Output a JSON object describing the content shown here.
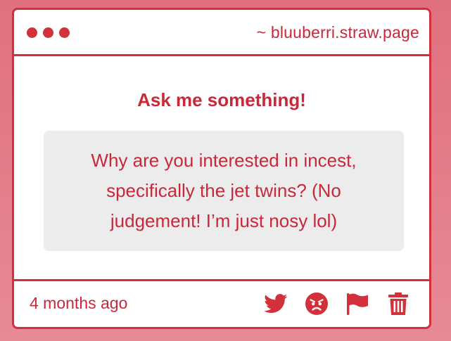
{
  "colors": {
    "accent": "#d2303a",
    "text": "#c8283a",
    "question_bg": "#ececec",
    "background_top": "#e0707e",
    "background_bottom": "#e78a96"
  },
  "window": {
    "dots": [
      "dot",
      "dot",
      "dot"
    ],
    "site_label": "~ bluuberri.straw.page"
  },
  "main": {
    "heading": "Ask me something!",
    "question": "Why are you interested in incest, specifically the jet twins? (No judgement! I’m just nosy lol)"
  },
  "footer": {
    "timestamp": "4 months ago",
    "actions": [
      {
        "name": "twitter-icon"
      },
      {
        "name": "angry-face-icon"
      },
      {
        "name": "flag-icon"
      },
      {
        "name": "trash-icon"
      }
    ]
  }
}
